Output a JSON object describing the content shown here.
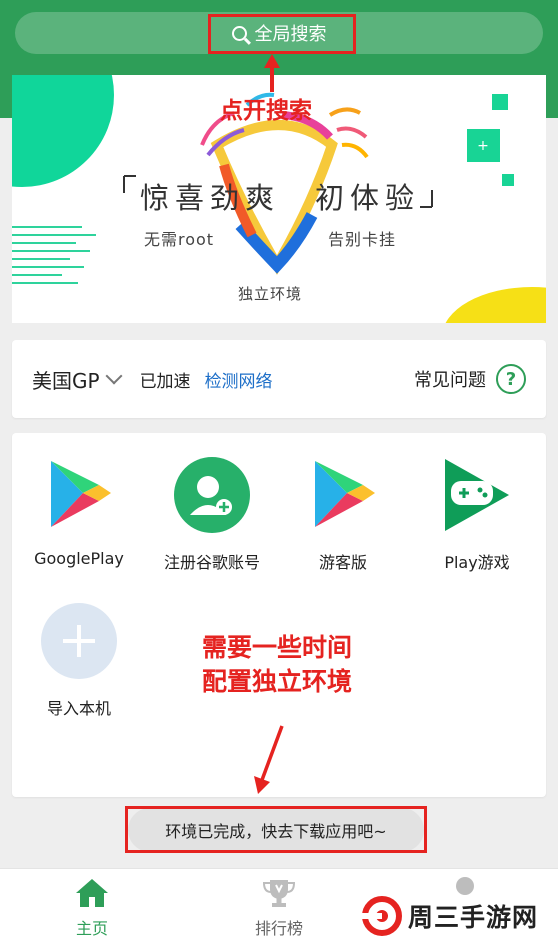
{
  "search": {
    "label": "全局搜索"
  },
  "annotations": {
    "search_hint": "点开搜索",
    "time_hint_1": "需要一些时间",
    "time_hint_2": "配置独立环境"
  },
  "banner": {
    "headline_left": "惊喜劲爽",
    "headline_right": "初体验",
    "sub_left": "无需root",
    "sub_right": "告别卡挂",
    "sub_bottom": "独立环境"
  },
  "region": {
    "selected": "美国GP",
    "status": "已加速",
    "check_link": "检测网络",
    "faq": "常见问题"
  },
  "apps": [
    {
      "label": "GooglePlay",
      "icon": "google-play-icon"
    },
    {
      "label": "注册谷歌账号",
      "icon": "add-google-account-icon"
    },
    {
      "label": "游客版",
      "icon": "google-play-guest-icon"
    },
    {
      "label": "Play游戏",
      "icon": "play-games-icon"
    },
    {
      "label": "导入本机",
      "icon": "plus-icon"
    }
  ],
  "status_message": "环境已完成，快去下载应用吧~",
  "tabs": [
    {
      "label": "主页",
      "icon": "home-icon",
      "active": true
    },
    {
      "label": "排行榜",
      "icon": "trophy-icon",
      "active": false
    }
  ],
  "watermark": "周三手游网",
  "colors": {
    "brand_green": "#2e9e58",
    "link_blue": "#1e6fc8",
    "annotation_red": "#e52320"
  }
}
